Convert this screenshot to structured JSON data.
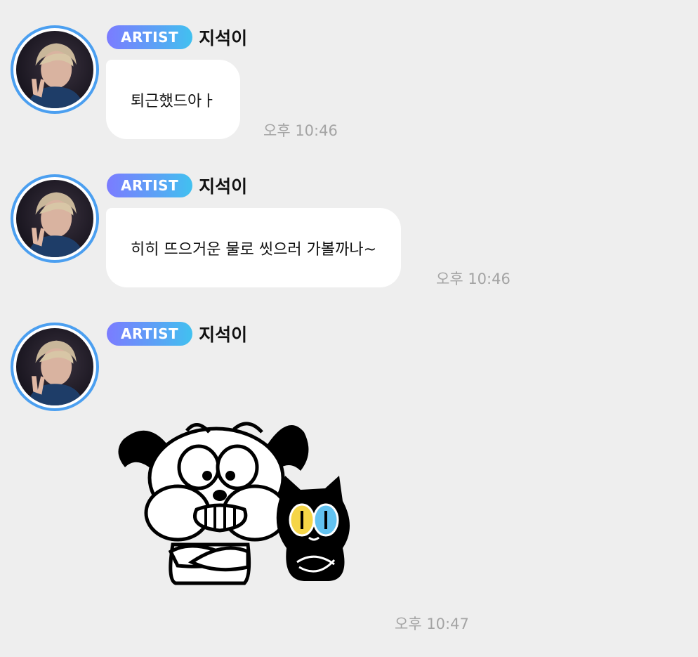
{
  "messages": [
    {
      "badge": "ARTIST",
      "sender": "지석이",
      "text": "퇴근했드아ㅏ",
      "time": "오후 10:46"
    },
    {
      "badge": "ARTIST",
      "sender": "지석이",
      "text": "히히 뜨으거운 물로 씻으러 가볼까나~",
      "time": "오후 10:46"
    },
    {
      "badge": "ARTIST",
      "sender": "지석이",
      "sticker": "dog-and-cat-sticker",
      "time": "오후 10:47"
    }
  ],
  "colors": {
    "background": "#eeeeee",
    "avatar_ring": "#4b9ff0",
    "badge_gradient_start": "#7b7cff",
    "badge_gradient_end": "#41c1f0",
    "timestamp": "#a4a4a4"
  }
}
